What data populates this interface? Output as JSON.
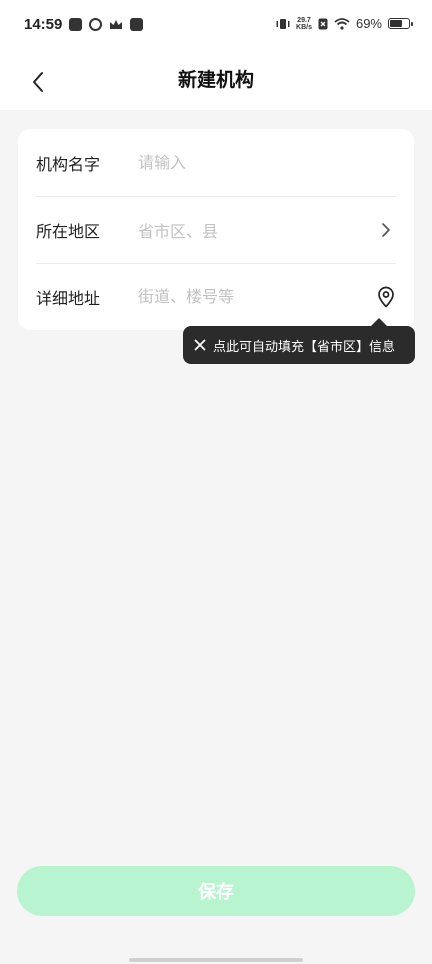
{
  "status_bar": {
    "time": "14:59",
    "net_speed_value": "29.7",
    "net_speed_unit": "KB/s",
    "battery_text": "69%",
    "battery_level": 0.69,
    "icons": [
      "app-notification-icon",
      "app-notification-icon",
      "crown-icon",
      "mail-icon",
      "vibrate-icon",
      "no-sim-icon",
      "wifi-icon",
      "battery-icon"
    ]
  },
  "nav": {
    "title": "新建机构",
    "back_icon": "chevron-left-icon"
  },
  "form": {
    "name": {
      "label": "机构名字",
      "placeholder": "请输入",
      "value": ""
    },
    "region": {
      "label": "所在地区",
      "placeholder": "省市区、县",
      "icon": "chevron-right-icon"
    },
    "address": {
      "label": "详细地址",
      "placeholder": "街道、楼号等",
      "value": "",
      "icon": "location-pin-icon"
    }
  },
  "tooltip": {
    "text": "点此可自动填充【省市区】信息",
    "close_icon": "close-icon"
  },
  "save_button": {
    "label": "保存"
  },
  "colors": {
    "accent_disabled": "#b9f4d0",
    "tooltip_bg": "#2b2b2b",
    "page_bg": "#f5f5f5"
  }
}
